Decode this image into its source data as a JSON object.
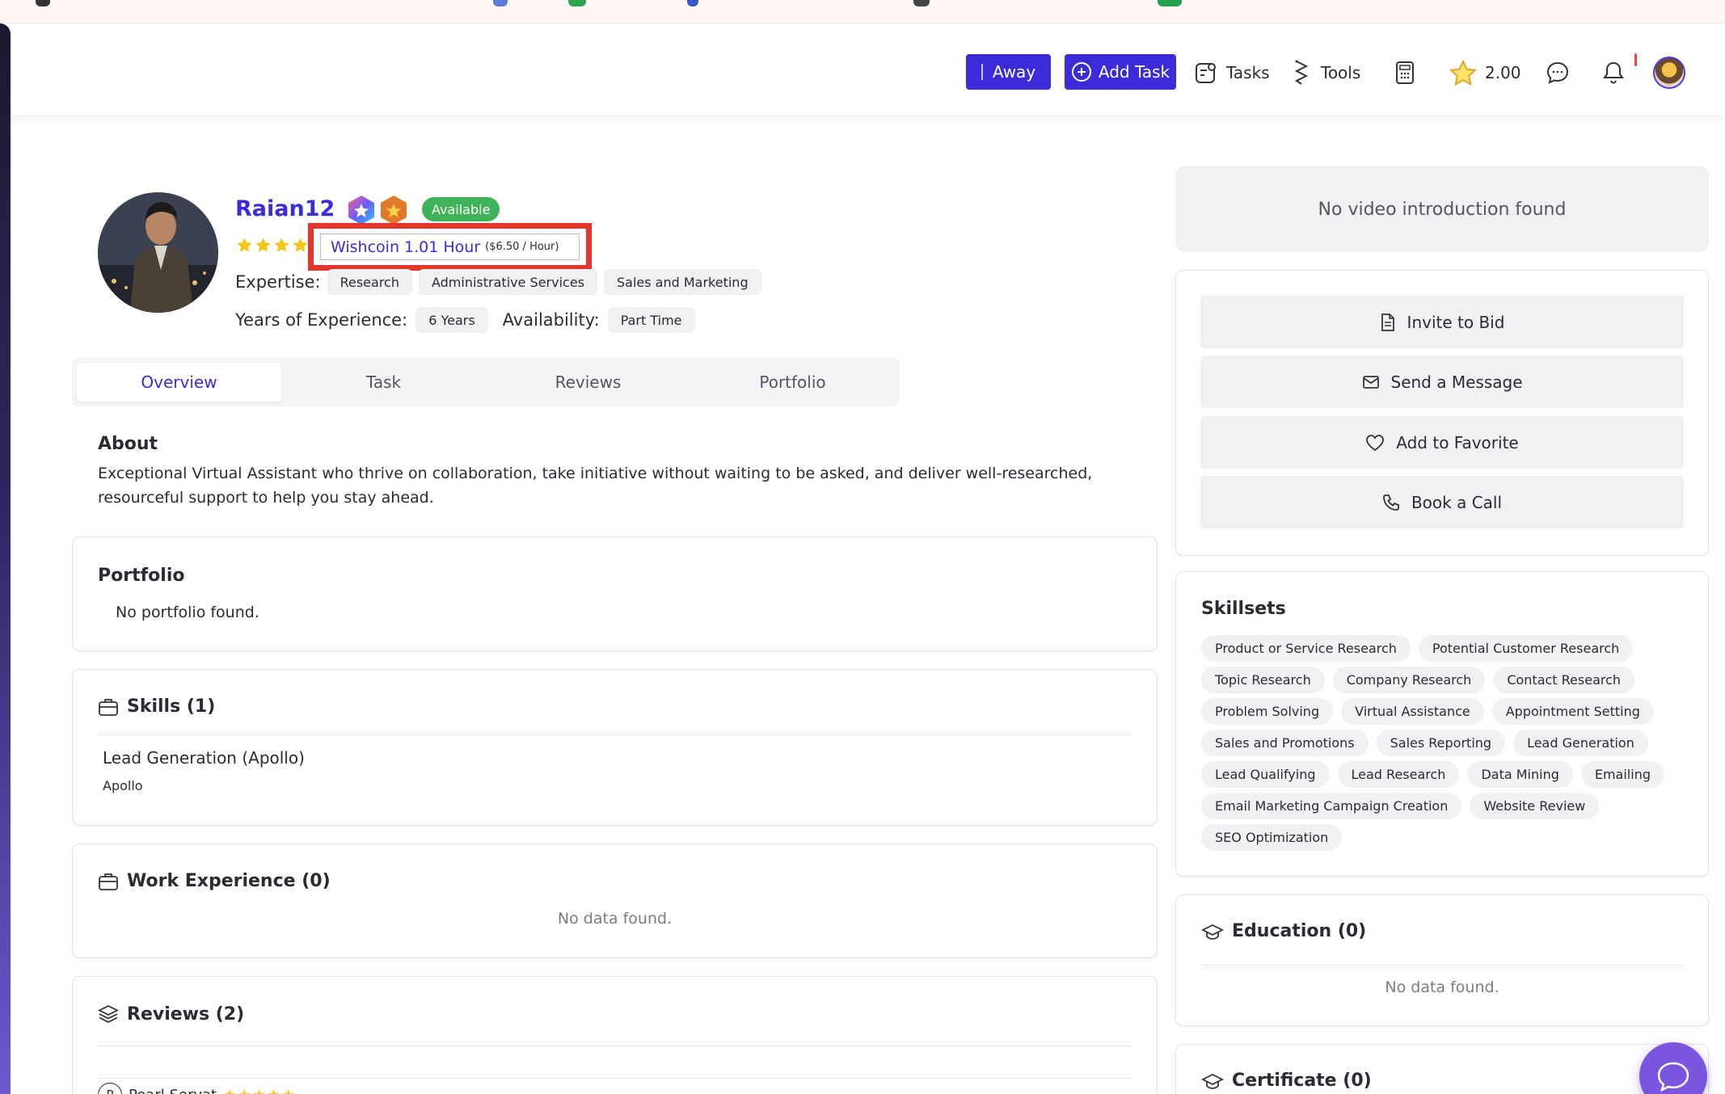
{
  "header": {
    "away_label": "Away",
    "add_task_label": "Add Task",
    "tasks_label": "Tasks",
    "tools_label": "Tools",
    "points_value": "2.00"
  },
  "profile": {
    "name": "Raian12",
    "status": "Available",
    "rating_stars": 5,
    "wishcoin_label": "Wishcoin 1.01 Hour",
    "wishcoin_rate": "($6.50 / Hour)",
    "expertise_label": "Expertise:",
    "expertise": [
      "Research",
      "Administrative Services",
      "Sales and Marketing"
    ],
    "experience_label": "Years of Experience:",
    "experience_value": "6 Years",
    "availability_label": "Availability:",
    "availability_value": "Part Time"
  },
  "tabs": [
    {
      "label": "Overview",
      "active": true
    },
    {
      "label": "Task",
      "active": false
    },
    {
      "label": "Reviews",
      "active": false
    },
    {
      "label": "Portfolio",
      "active": false
    }
  ],
  "about": {
    "title": "About",
    "line1": "Exceptional Virtual Assistant who thrive on collaboration, take initiative without waiting to be asked, and deliver well-researched,",
    "line2": "resourceful support to help you stay ahead."
  },
  "portfolio": {
    "title": "Portfolio",
    "empty": "No portfolio found."
  },
  "skills": {
    "title": "Skills (1)",
    "item_title": "Lead Generation (Apollo)",
    "item_tool": "Apollo"
  },
  "work_experience": {
    "title": "Work Experience (0)",
    "empty": "No data found."
  },
  "reviews": {
    "title": "Reviews (2)",
    "first_reviewer": "Pearl Servat",
    "first_initial": "P"
  },
  "video": {
    "empty": "No video introduction found"
  },
  "actions": {
    "invite": "Invite to Bid",
    "message": "Send a Message",
    "favorite": "Add to Favorite",
    "call": "Book a Call"
  },
  "skillsets": {
    "title": "Skillsets",
    "rows": [
      [
        "Product or Service Research",
        "Potential Customer Research"
      ],
      [
        "Topic Research",
        "Company Research",
        "Contact Research"
      ],
      [
        "Problem Solving",
        "Virtual Assistance",
        "Appointment Setting"
      ],
      [
        "Sales and Promotions",
        "Sales Reporting",
        "Lead Generation"
      ],
      [
        "Lead Qualifying",
        "Lead Research",
        "Data Mining",
        "Emailing"
      ],
      [
        "Email Marketing Campaign Creation",
        "Website Review"
      ],
      [
        "SEO Optimization"
      ]
    ]
  },
  "education": {
    "title": "Education (0)",
    "empty": "No data found."
  },
  "certificate": {
    "title": "Certificate (0)"
  },
  "colors": {
    "brand": "#3b2bd9",
    "available": "#3fb35a",
    "highlight": "#e5352a",
    "star": "#f5c518"
  }
}
